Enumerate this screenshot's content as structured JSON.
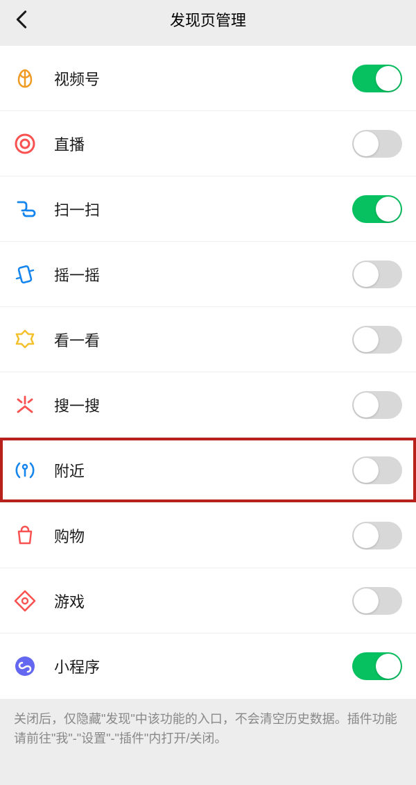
{
  "header": {
    "title": "发现页管理"
  },
  "items": [
    {
      "key": "channels",
      "label": "视频号",
      "on": true
    },
    {
      "key": "live",
      "label": "直播",
      "on": false
    },
    {
      "key": "scan",
      "label": "扫一扫",
      "on": true
    },
    {
      "key": "shake",
      "label": "摇一摇",
      "on": false
    },
    {
      "key": "topstories",
      "label": "看一看",
      "on": false
    },
    {
      "key": "search",
      "label": "搜一搜",
      "on": false
    },
    {
      "key": "nearby",
      "label": "附近",
      "on": false,
      "highlight": true
    },
    {
      "key": "shopping",
      "label": "购物",
      "on": false
    },
    {
      "key": "games",
      "label": "游戏",
      "on": false
    },
    {
      "key": "miniapp",
      "label": "小程序",
      "on": true
    }
  ],
  "footer": "关闭后，仅隐藏\"发现\"中该功能的入口，不会清空历史数据。插件功能请前往\"我\"-\"设置\"-\"插件\"内打开/关闭。"
}
